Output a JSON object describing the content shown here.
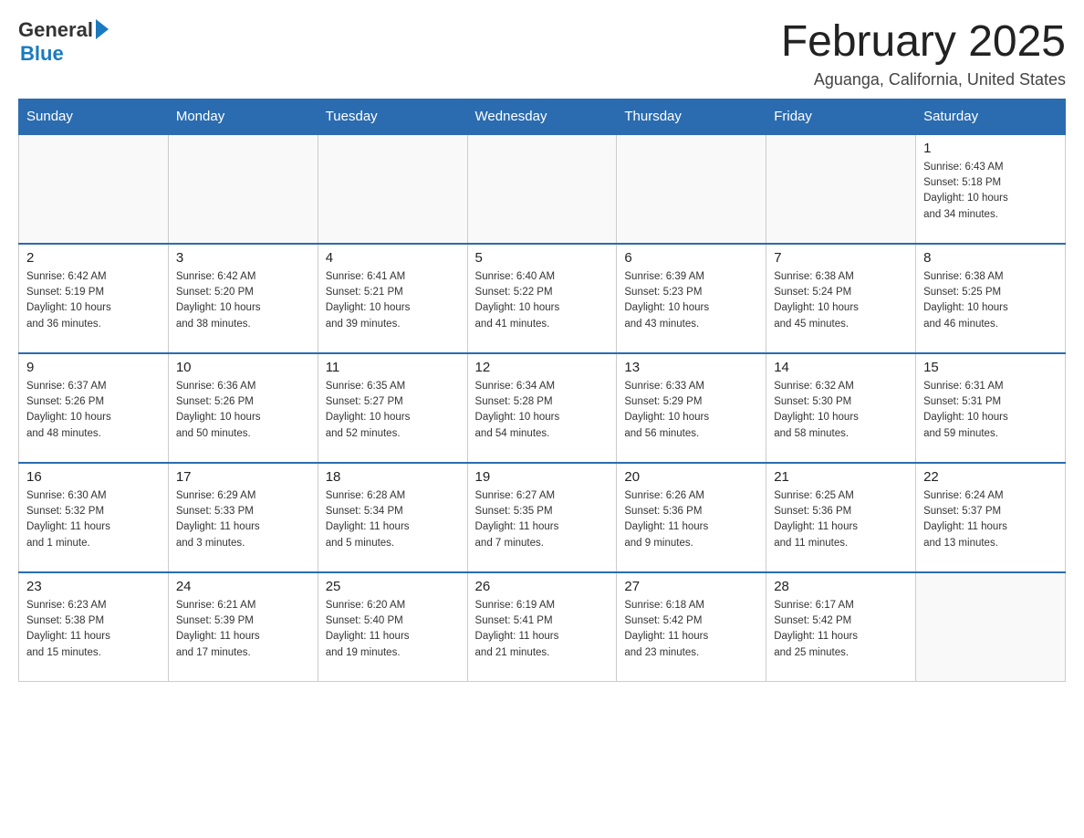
{
  "header": {
    "logo_general": "General",
    "logo_blue": "Blue",
    "month_title": "February 2025",
    "location": "Aguanga, California, United States"
  },
  "weekdays": [
    "Sunday",
    "Monday",
    "Tuesday",
    "Wednesday",
    "Thursday",
    "Friday",
    "Saturday"
  ],
  "weeks": [
    [
      {
        "day": "",
        "info": ""
      },
      {
        "day": "",
        "info": ""
      },
      {
        "day": "",
        "info": ""
      },
      {
        "day": "",
        "info": ""
      },
      {
        "day": "",
        "info": ""
      },
      {
        "day": "",
        "info": ""
      },
      {
        "day": "1",
        "info": "Sunrise: 6:43 AM\nSunset: 5:18 PM\nDaylight: 10 hours\nand 34 minutes."
      }
    ],
    [
      {
        "day": "2",
        "info": "Sunrise: 6:42 AM\nSunset: 5:19 PM\nDaylight: 10 hours\nand 36 minutes."
      },
      {
        "day": "3",
        "info": "Sunrise: 6:42 AM\nSunset: 5:20 PM\nDaylight: 10 hours\nand 38 minutes."
      },
      {
        "day": "4",
        "info": "Sunrise: 6:41 AM\nSunset: 5:21 PM\nDaylight: 10 hours\nand 39 minutes."
      },
      {
        "day": "5",
        "info": "Sunrise: 6:40 AM\nSunset: 5:22 PM\nDaylight: 10 hours\nand 41 minutes."
      },
      {
        "day": "6",
        "info": "Sunrise: 6:39 AM\nSunset: 5:23 PM\nDaylight: 10 hours\nand 43 minutes."
      },
      {
        "day": "7",
        "info": "Sunrise: 6:38 AM\nSunset: 5:24 PM\nDaylight: 10 hours\nand 45 minutes."
      },
      {
        "day": "8",
        "info": "Sunrise: 6:38 AM\nSunset: 5:25 PM\nDaylight: 10 hours\nand 46 minutes."
      }
    ],
    [
      {
        "day": "9",
        "info": "Sunrise: 6:37 AM\nSunset: 5:26 PM\nDaylight: 10 hours\nand 48 minutes."
      },
      {
        "day": "10",
        "info": "Sunrise: 6:36 AM\nSunset: 5:26 PM\nDaylight: 10 hours\nand 50 minutes."
      },
      {
        "day": "11",
        "info": "Sunrise: 6:35 AM\nSunset: 5:27 PM\nDaylight: 10 hours\nand 52 minutes."
      },
      {
        "day": "12",
        "info": "Sunrise: 6:34 AM\nSunset: 5:28 PM\nDaylight: 10 hours\nand 54 minutes."
      },
      {
        "day": "13",
        "info": "Sunrise: 6:33 AM\nSunset: 5:29 PM\nDaylight: 10 hours\nand 56 minutes."
      },
      {
        "day": "14",
        "info": "Sunrise: 6:32 AM\nSunset: 5:30 PM\nDaylight: 10 hours\nand 58 minutes."
      },
      {
        "day": "15",
        "info": "Sunrise: 6:31 AM\nSunset: 5:31 PM\nDaylight: 10 hours\nand 59 minutes."
      }
    ],
    [
      {
        "day": "16",
        "info": "Sunrise: 6:30 AM\nSunset: 5:32 PM\nDaylight: 11 hours\nand 1 minute."
      },
      {
        "day": "17",
        "info": "Sunrise: 6:29 AM\nSunset: 5:33 PM\nDaylight: 11 hours\nand 3 minutes."
      },
      {
        "day": "18",
        "info": "Sunrise: 6:28 AM\nSunset: 5:34 PM\nDaylight: 11 hours\nand 5 minutes."
      },
      {
        "day": "19",
        "info": "Sunrise: 6:27 AM\nSunset: 5:35 PM\nDaylight: 11 hours\nand 7 minutes."
      },
      {
        "day": "20",
        "info": "Sunrise: 6:26 AM\nSunset: 5:36 PM\nDaylight: 11 hours\nand 9 minutes."
      },
      {
        "day": "21",
        "info": "Sunrise: 6:25 AM\nSunset: 5:36 PM\nDaylight: 11 hours\nand 11 minutes."
      },
      {
        "day": "22",
        "info": "Sunrise: 6:24 AM\nSunset: 5:37 PM\nDaylight: 11 hours\nand 13 minutes."
      }
    ],
    [
      {
        "day": "23",
        "info": "Sunrise: 6:23 AM\nSunset: 5:38 PM\nDaylight: 11 hours\nand 15 minutes."
      },
      {
        "day": "24",
        "info": "Sunrise: 6:21 AM\nSunset: 5:39 PM\nDaylight: 11 hours\nand 17 minutes."
      },
      {
        "day": "25",
        "info": "Sunrise: 6:20 AM\nSunset: 5:40 PM\nDaylight: 11 hours\nand 19 minutes."
      },
      {
        "day": "26",
        "info": "Sunrise: 6:19 AM\nSunset: 5:41 PM\nDaylight: 11 hours\nand 21 minutes."
      },
      {
        "day": "27",
        "info": "Sunrise: 6:18 AM\nSunset: 5:42 PM\nDaylight: 11 hours\nand 23 minutes."
      },
      {
        "day": "28",
        "info": "Sunrise: 6:17 AM\nSunset: 5:42 PM\nDaylight: 11 hours\nand 25 minutes."
      },
      {
        "day": "",
        "info": ""
      }
    ]
  ]
}
